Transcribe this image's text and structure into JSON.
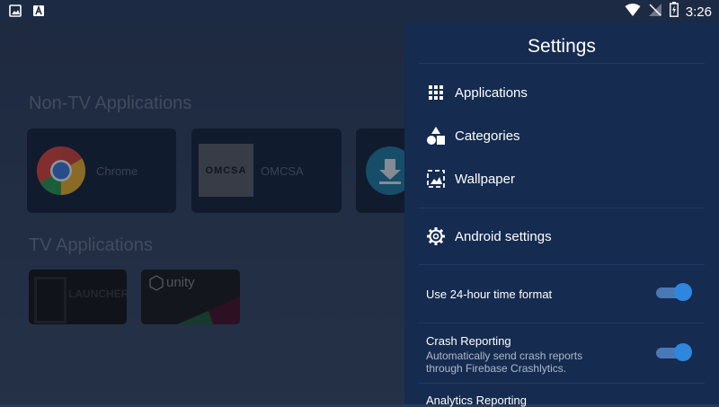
{
  "status_bar": {
    "time": "3:26",
    "left_icons": [
      "image-icon",
      "a-icon"
    ],
    "right_icons": [
      "wifi-icon",
      "no-signal-icon",
      "battery-charging-icon"
    ]
  },
  "launcher": {
    "non_tv_title": "Non-TV Applications",
    "tv_title": "TV Applications",
    "non_tv_apps": [
      {
        "name": "Chrome",
        "icon": "chrome-icon"
      },
      {
        "name": "OMCSA",
        "logo_text": "OMCSA"
      },
      {
        "name": "",
        "icon": "download-icon"
      }
    ],
    "tv_apps": [
      {
        "name": "LAUNCHER",
        "logo": "launcher-logo"
      },
      {
        "name": "unity",
        "logo": "unity-logo"
      }
    ]
  },
  "settings": {
    "title": "Settings",
    "menu": [
      {
        "label": "Applications",
        "icon": "grid-icon"
      },
      {
        "label": "Categories",
        "icon": "shapes-icon"
      },
      {
        "label": "Wallpaper",
        "icon": "wallpaper-icon"
      },
      {
        "label": "Android settings",
        "icon": "gear-icon"
      }
    ],
    "toggles": [
      {
        "title": "Use 24-hour time format",
        "description": "",
        "enabled": true
      },
      {
        "title": "Crash Reporting",
        "description_line1": "Automatically send crash reports",
        "description_line2": "through Firebase Crashlytics.",
        "enabled": true
      },
      {
        "title": "Analytics Reporting"
      }
    ]
  },
  "colors": {
    "panel": "#152b4f",
    "toggle_on": "#2e86de"
  }
}
